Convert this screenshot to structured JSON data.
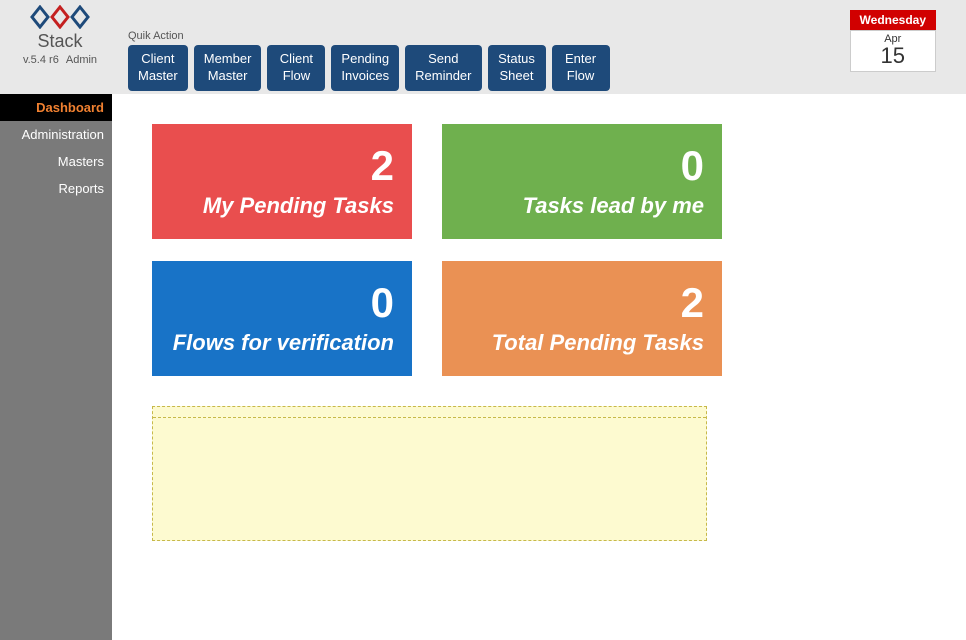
{
  "app": {
    "name": "Stack",
    "version": "v.5.4 r6",
    "role": "Admin"
  },
  "quick_action_label": "Quik Action",
  "actions": {
    "client_master": "Client\nMaster",
    "member_master": "Member\nMaster",
    "client_flow": "Client\nFlow",
    "pending_invoices": "Pending\nInvoices",
    "send_reminder": "Send\nReminder",
    "status_sheet": "Status\nSheet",
    "enter_flow": "Enter\nFlow"
  },
  "date": {
    "day_name": "Wednesday",
    "month": "Apr",
    "day_num": "15"
  },
  "sidebar": {
    "dashboard": "Dashboard",
    "administration": "Administration",
    "masters": "Masters",
    "reports": "Reports"
  },
  "cards": {
    "my_pending_tasks": {
      "value": "2",
      "label": "My Pending Tasks"
    },
    "tasks_lead": {
      "value": "0",
      "label": "Tasks lead by me"
    },
    "flows_verification": {
      "value": "0",
      "label": "Flows for verification"
    },
    "total_pending": {
      "value": "2",
      "label": "Total Pending Tasks"
    }
  }
}
